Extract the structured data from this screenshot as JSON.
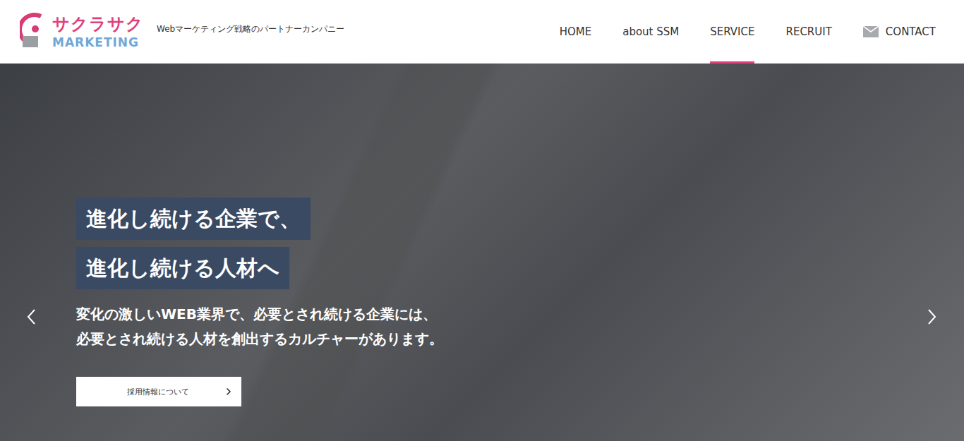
{
  "header": {
    "logo": {
      "top": "サクラサク",
      "bottom": "MARKETING"
    },
    "tagline": "Webマーケティング戦略のパートナーカンパニー"
  },
  "nav": [
    {
      "label": "HOME",
      "selected": false,
      "kind": "link"
    },
    {
      "label": "about SSM",
      "selected": false,
      "kind": "link"
    },
    {
      "label": "SERVICE",
      "selected": true,
      "kind": "link"
    },
    {
      "label": "RECRUIT",
      "selected": false,
      "kind": "link"
    },
    {
      "label": "CONTACT",
      "selected": false,
      "kind": "mail"
    }
  ],
  "hero": {
    "headline": [
      "進化し続ける企業で、",
      "進化し続ける人材へ"
    ],
    "lead": [
      "変化の激しいWEB業界で、必要とされ続ける企業には、",
      "必要とされ続ける人材を創出するカルチャーがあります。"
    ],
    "button": {
      "label": "採用情報について"
    }
  }
}
